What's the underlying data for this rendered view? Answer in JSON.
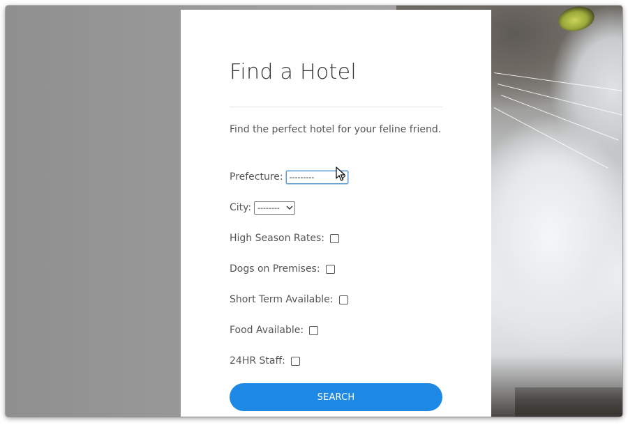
{
  "page": {
    "title": "Find a Hotel",
    "subtitle": "Find the perfect hotel for your feline friend."
  },
  "form": {
    "prefecture": {
      "label": "Prefecture:",
      "selected": "---------"
    },
    "city": {
      "label": "City:",
      "selected": "--------"
    },
    "checkboxes": [
      {
        "label": "High Season Rates:",
        "checked": false
      },
      {
        "label": "Dogs on Premises:",
        "checked": false
      },
      {
        "label": "Short Term Available:",
        "checked": false
      },
      {
        "label": "Food Available:",
        "checked": false
      },
      {
        "label": "24HR Staff:",
        "checked": false
      }
    ],
    "search_label": "SEARCH"
  },
  "colors": {
    "accent": "#1e88e5",
    "panel": "#ffffff",
    "background_wall": "#9a9a9a",
    "text": "#555555",
    "title": "#333333"
  },
  "icons": {
    "select_arrow": "chevron-down-icon",
    "pointer": "mouse-cursor-icon"
  }
}
